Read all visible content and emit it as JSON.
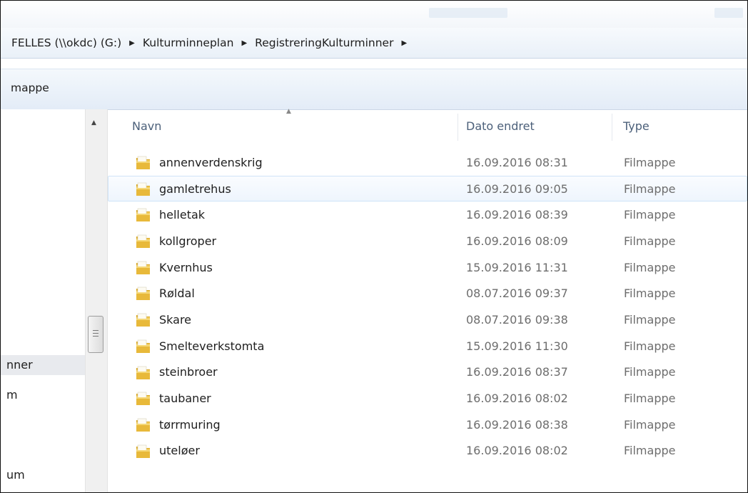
{
  "address": {
    "crumbs": [
      "FELLES (\\\\okdc) (G:)",
      "Kulturminneplan",
      "RegistreringKulturminner"
    ]
  },
  "toolbar": {
    "new_folder_label": "mappe"
  },
  "nav": {
    "items": [
      {
        "label": "nner",
        "selected": true
      },
      {
        "label": "m",
        "selected": false
      },
      {
        "label": "um",
        "selected": false
      }
    ]
  },
  "columns": {
    "name": "Navn",
    "date": "Dato endret",
    "type": "Type"
  },
  "files": [
    {
      "name": "annenverdenskrig",
      "date": "16.09.2016 08:31",
      "type": "Filmappe"
    },
    {
      "name": "gamletrehus",
      "date": "16.09.2016 09:05",
      "type": "Filmappe",
      "hover": true
    },
    {
      "name": "helletak",
      "date": "16.09.2016 08:39",
      "type": "Filmappe"
    },
    {
      "name": "kollgroper",
      "date": "16.09.2016 08:09",
      "type": "Filmappe"
    },
    {
      "name": "Kvernhus",
      "date": "15.09.2016 11:31",
      "type": "Filmappe"
    },
    {
      "name": "Røldal",
      "date": "08.07.2016 09:37",
      "type": "Filmappe"
    },
    {
      "name": "Skare",
      "date": "08.07.2016 09:38",
      "type": "Filmappe"
    },
    {
      "name": "Smelteverkstomta",
      "date": "15.09.2016 11:30",
      "type": "Filmappe"
    },
    {
      "name": "steinbroer",
      "date": "16.09.2016 08:37",
      "type": "Filmappe"
    },
    {
      "name": "taubaner",
      "date": "16.09.2016 08:02",
      "type": "Filmappe"
    },
    {
      "name": "tørrmuring",
      "date": "16.09.2016 08:38",
      "type": "Filmappe"
    },
    {
      "name": "uteløer",
      "date": "16.09.2016 08:02",
      "type": "Filmappe"
    }
  ],
  "icons": {
    "folder": "folder-icon",
    "breadcrumb_separator": "chevron-right-icon",
    "scroll_up": "arrow-up-icon"
  },
  "colors": {
    "folder": "#e8b93a",
    "hover_border": "#cfe3f8",
    "header_text": "#4c607a"
  }
}
